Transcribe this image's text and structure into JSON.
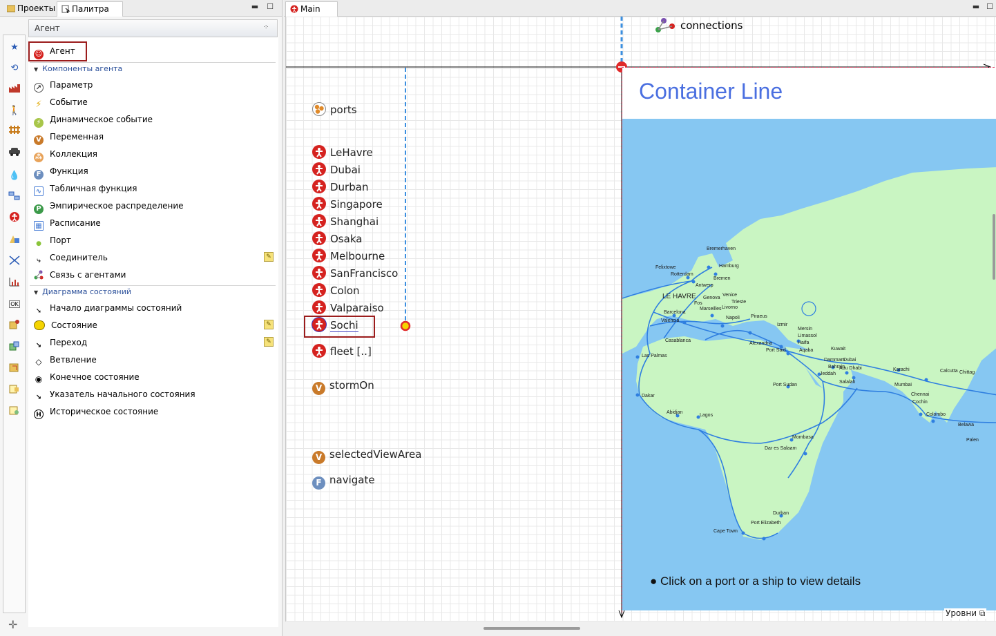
{
  "left_tabs": [
    {
      "label": "Проекты"
    },
    {
      "label": "Палитра"
    }
  ],
  "palette": {
    "header": "Агент",
    "agent_item": "Агент",
    "section_components": "Компоненты агента",
    "components": [
      {
        "label": "Параметр",
        "icon": "parameter-icon"
      },
      {
        "label": "Событие",
        "icon": "event-icon"
      },
      {
        "label": "Динамическое событие",
        "icon": "dynamic-event-icon"
      },
      {
        "label": "Переменная",
        "icon": "variable-icon"
      },
      {
        "label": "Коллекция",
        "icon": "collection-icon"
      },
      {
        "label": "Функция",
        "icon": "function-icon"
      },
      {
        "label": "Табличная функция",
        "icon": "table-function-icon"
      },
      {
        "label": "Эмпирическое распределение",
        "icon": "distribution-icon"
      },
      {
        "label": "Расписание",
        "icon": "schedule-icon"
      },
      {
        "label": "Порт",
        "icon": "port-icon"
      },
      {
        "label": "Соединитель",
        "icon": "connector-icon"
      },
      {
        "label": "Связь с агентами",
        "icon": "agent-link-icon"
      }
    ],
    "section_statechart": "Диаграмма состояний",
    "statechart": [
      {
        "label": "Начало диаграммы состояний",
        "icon": "statechart-entry-icon"
      },
      {
        "label": "Состояние",
        "icon": "state-icon"
      },
      {
        "label": "Переход",
        "icon": "transition-icon"
      },
      {
        "label": "Ветвление",
        "icon": "branch-icon"
      },
      {
        "label": "Конечное состояние",
        "icon": "final-state-icon"
      },
      {
        "label": "Указатель начального состояния",
        "icon": "initial-pointer-icon"
      },
      {
        "label": "Историческое состояние",
        "icon": "history-state-icon"
      }
    ]
  },
  "editor": {
    "tab": "Main",
    "connections_label": "connections",
    "ports_label": "ports",
    "agents": [
      "LeHavre",
      "Dubai",
      "Durban",
      "Singapore",
      "Shanghai",
      "Osaka",
      "Melbourne",
      "SanFrancisco",
      "Colon",
      "Valparaiso",
      "Sochi"
    ],
    "fleet_label": "fleet [..]",
    "storm_label": "stormOn",
    "selected_view_label": "selectedViewArea",
    "navigate_label": "navigate",
    "view_title": "Container Line",
    "hint": "● Click on a port or a ship to view details",
    "levels": "Уровни",
    "map_labels": [
      "Bremerhaven",
      "Hamburg",
      "Felixtowe",
      "Rotterdam",
      "Bremen",
      "Antwerp",
      "LE HAVRE",
      "Genova",
      "Venice",
      "Trieste",
      "Fos",
      "Marseilles",
      "Livorno",
      "Barcelona",
      "Valencia",
      "Napoli",
      "Piraeus",
      "Izmir",
      "Mersin",
      "Limassol",
      "Haifa",
      "Alexandria",
      "Port Said",
      "Aqaba",
      "Casablanca",
      "Las Palmas",
      "Kuwait",
      "Dammam",
      "Bahrain",
      "Dubai",
      "Abu Dhabi",
      "Jeddah",
      "Karachi",
      "Calcutta",
      "Chittag",
      "Mumbai",
      "Port Sudan",
      "Salalah",
      "Chennai",
      "Cochin",
      "Colombo",
      "Dakar",
      "Abidjan",
      "Lagos",
      "Belawa",
      "Palen",
      "Mombasa",
      "Dar es Salaam",
      "Durban",
      "Port Elizabeth",
      "Cape Town"
    ],
    "colors": {
      "title": "#4a6fe0",
      "sea": "#86c7f2",
      "land": "#c9f5c2",
      "route": "#2f7fe0",
      "agent": "#d5221f"
    }
  }
}
